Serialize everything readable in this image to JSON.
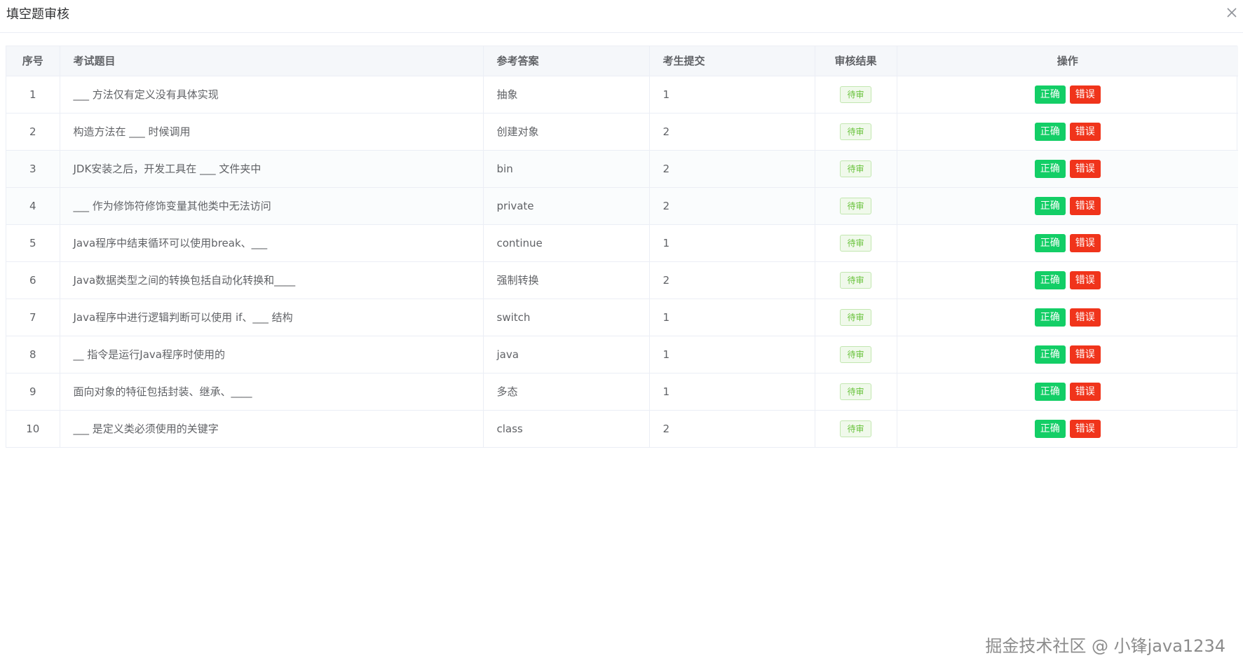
{
  "dialog": {
    "title": "填空题审核"
  },
  "table": {
    "headers": {
      "index": "序号",
      "question": "考试题目",
      "answer": "参考答案",
      "submitted": "考生提交",
      "result": "审核结果",
      "actions": "操作"
    },
    "rows": [
      {
        "index": "1",
        "question": "___ 方法仅有定义没有具体实现",
        "answer": "抽象",
        "submitted": "1",
        "status": "待审"
      },
      {
        "index": "2",
        "question": "构造方法在 ___ 时候调用",
        "answer": "创建对象",
        "submitted": "2",
        "status": "待审"
      },
      {
        "index": "3",
        "question": "JDK安装之后，开发工具在 ___ 文件夹中",
        "answer": "bin",
        "submitted": "2",
        "status": "待审"
      },
      {
        "index": "4",
        "question": "___ 作为修饰符修饰变量其他类中无法访问",
        "answer": "private",
        "submitted": "2",
        "status": "待审"
      },
      {
        "index": "5",
        "question": "Java程序中结束循环可以使用break、___",
        "answer": "continue",
        "submitted": "1",
        "status": "待审"
      },
      {
        "index": "6",
        "question": "Java数据类型之间的转换包括自动化转换和____",
        "answer": "强制转换",
        "submitted": "2",
        "status": "待审"
      },
      {
        "index": "7",
        "question": "Java程序中进行逻辑判断可以使用 if、___ 结构",
        "answer": "switch",
        "submitted": "1",
        "status": "待审"
      },
      {
        "index": "8",
        "question": "__ 指令是运行Java程序时使用的",
        "answer": "java",
        "submitted": "1",
        "status": "待审"
      },
      {
        "index": "9",
        "question": "面向对象的特征包括封装、继承、____",
        "answer": "多态",
        "submitted": "1",
        "status": "待审"
      },
      {
        "index": "10",
        "question": "___ 是定义类必须使用的关键字",
        "answer": "class",
        "submitted": "2",
        "status": "待审"
      }
    ],
    "action_labels": {
      "correct": "正确",
      "wrong": "错误"
    }
  },
  "watermark": "掘金技术社区 @ 小锋java1234",
  "colors": {
    "correct_button": "#13ce66",
    "wrong_button": "#f0341b",
    "pending_tag": "#67c23a",
    "header_bg": "#f5f7fa"
  },
  "icons": {
    "close": "close-icon"
  }
}
